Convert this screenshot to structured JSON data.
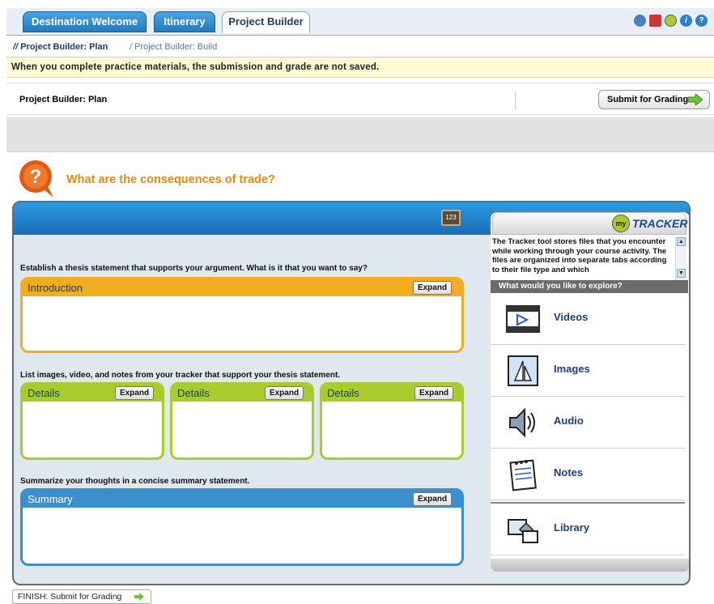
{
  "tabs": [
    {
      "label": "Destination Welcome"
    },
    {
      "label": "Itinerary"
    },
    {
      "label": "Project Builder"
    }
  ],
  "top_icons": [
    "people-icon",
    "book-icon",
    "my-icon",
    "info-icon",
    "help-icon"
  ],
  "subnav": {
    "plan": "Project Builder: Plan",
    "build": "Project Builder: Build"
  },
  "notice": "When you complete practice materials, the submission and grade are not saved.",
  "planbar": {
    "label": "Project Builder: Plan",
    "submit": "Submit for Grading"
  },
  "question": "What are the consequences of trade?",
  "calc_label": "123",
  "workspace": {
    "thesis_instruction": "Establish a thesis statement that supports your argument. What is it that you want to say?",
    "introduction": "Introduction",
    "details_instruction": "List images, video, and notes from your tracker that support your thesis statement.",
    "details": [
      "Details",
      "Details",
      "Details"
    ],
    "summary_instruction": "Summarize your thoughts in a concise summary statement.",
    "summary": "Summary",
    "expand": "Expand"
  },
  "tracker": {
    "badge": "my",
    "title": "TRACKER",
    "description": "The Tracker tool stores files that you encounter while working through your course activity. The files are organized into separate tabs according to their file type and which",
    "explore": "What would you like to explore?",
    "items": [
      {
        "label": "Videos",
        "icon": "video-icon"
      },
      {
        "label": "Images",
        "icon": "image-icon"
      },
      {
        "label": "Audio",
        "icon": "audio-icon"
      },
      {
        "label": "Notes",
        "icon": "notes-icon"
      },
      {
        "label": "Library",
        "icon": "library-icon"
      }
    ]
  },
  "finish": "FINISH: Submit for Grading",
  "colors": {
    "tab_blue": "#1f7cc4",
    "question_orange": "#e58a0c",
    "intro_orange": "#f2ac20",
    "details_green": "#a7cc2c",
    "summary_blue": "#3a8fcc",
    "notice_yellow": "#fdfbd2"
  }
}
